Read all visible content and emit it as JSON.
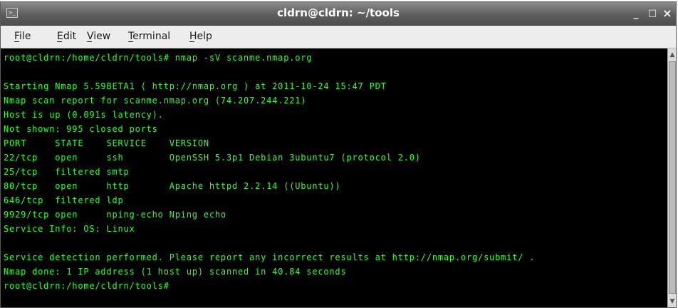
{
  "window": {
    "title": "cldrn@cldrn: ~/tools",
    "icon": "terminal-window-icon",
    "controls": {
      "minimize": "_",
      "maximize": "□",
      "close": "×"
    }
  },
  "menubar": {
    "items": [
      {
        "label": "File"
      },
      {
        "label": "Edit"
      },
      {
        "label": "View"
      },
      {
        "label": "Terminal"
      },
      {
        "label": "Help"
      }
    ]
  },
  "terminal": {
    "text_color": "#33ff33",
    "background": "#000000",
    "lines": [
      "root@cldrn:/home/cldrn/tools# nmap -sV scanme.nmap.org",
      "",
      "Starting Nmap 5.59BETA1 ( http://nmap.org ) at 2011-10-24 15:47 PDT",
      "Nmap scan report for scanme.nmap.org (74.207.244.221)",
      "Host is up (0.091s latency).",
      "Not shown: 995 closed ports",
      "PORT     STATE    SERVICE    VERSION",
      "22/tcp   open     ssh        OpenSSH 5.3p1 Debian 3ubuntu7 (protocol 2.0)",
      "25/tcp   filtered smtp",
      "80/tcp   open     http       Apache httpd 2.2.14 ((Ubuntu))",
      "646/tcp  filtered ldp",
      "9929/tcp open     nping-echo Nping echo",
      "Service Info: OS: Linux",
      "",
      "Service detection performed. Please report any incorrect results at http://nmap.org/submit/ .",
      "Nmap done: 1 IP address (1 host up) scanned in 40.84 seconds",
      "root@cldrn:/home/cldrn/tools#"
    ]
  },
  "scrollbar": {
    "up_icon": "▲",
    "down_icon": "▼"
  }
}
